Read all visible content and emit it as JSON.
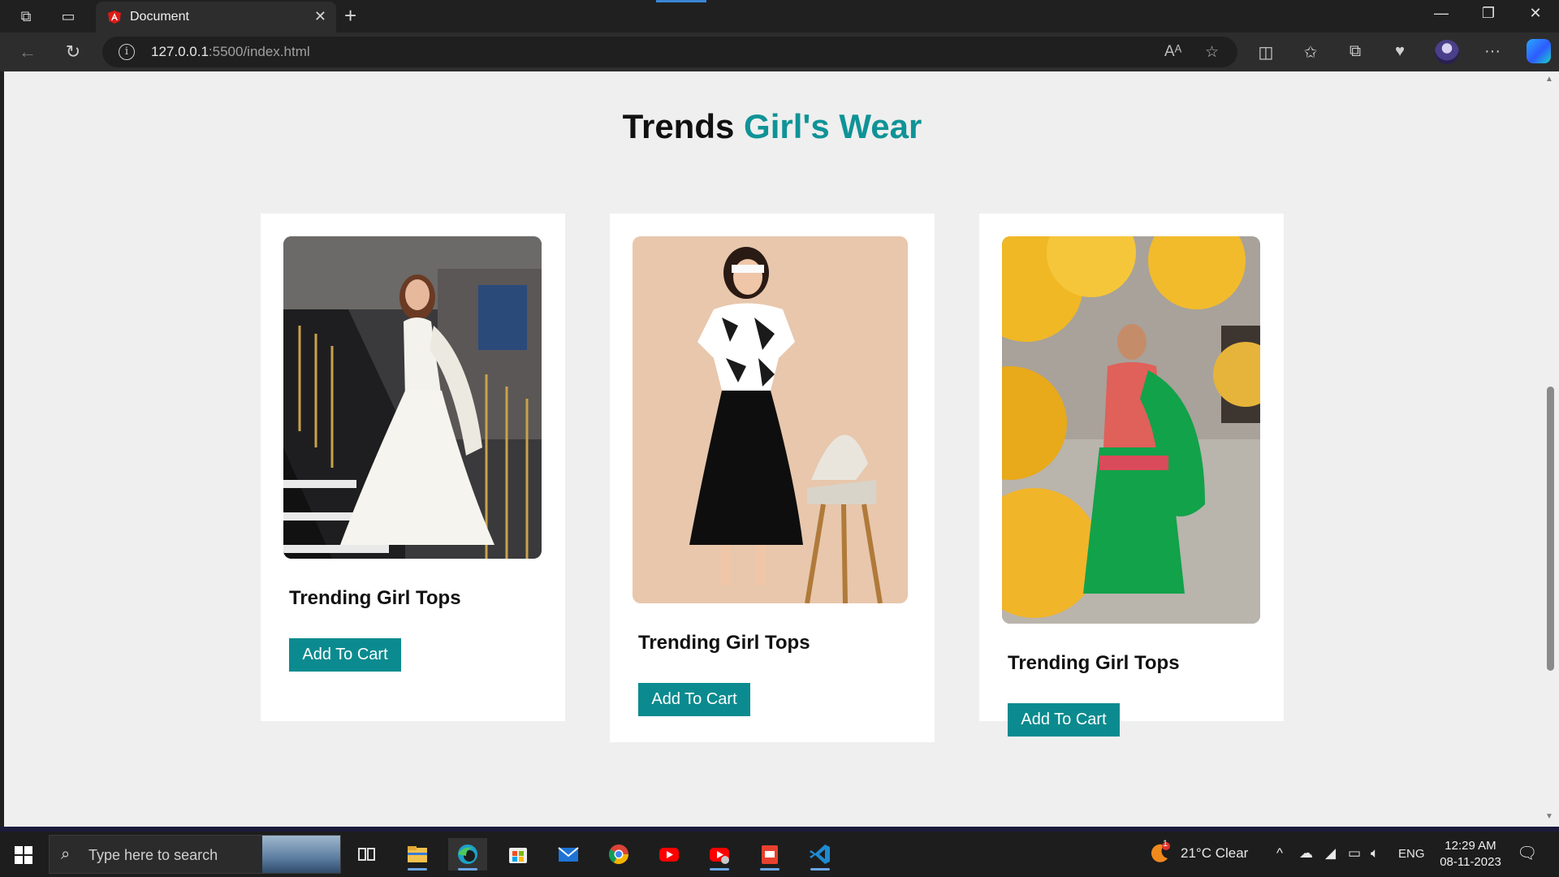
{
  "browser": {
    "tab_title": "Document",
    "url_host": "127.0.0.1",
    "url_path": ":5500/index.html"
  },
  "page": {
    "heading_main": "Trends",
    "heading_accent": "Girl's Wear",
    "cards": [
      {
        "title": "Trending Girl Tops",
        "button": "Add To Cart",
        "photo": "white anarkali dress on staircase"
      },
      {
        "title": "Trending Girl Tops",
        "button": "Add To Cart",
        "photo": "black dress with printed top and chair"
      },
      {
        "title": "Trending Girl Tops",
        "button": "Add To Cart",
        "photo": "green sharara suit among yellow flowers"
      }
    ]
  },
  "taskbar": {
    "search_placeholder": "Type here to search",
    "weather": "21°C  Clear",
    "weather_badge": "1",
    "language": "ENG",
    "time": "12:29 AM",
    "date": "08-11-2023"
  },
  "colors": {
    "accent": "#0f9397",
    "button": "#0b8b8f"
  }
}
